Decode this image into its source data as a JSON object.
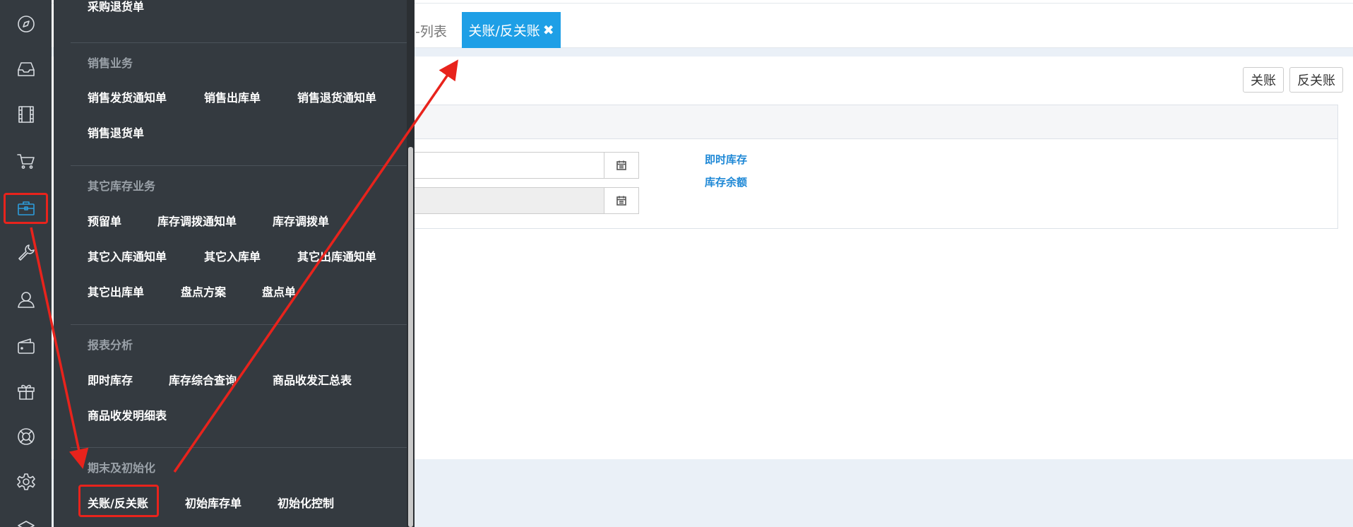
{
  "rail": {
    "icons": [
      "compass-icon",
      "inbox-icon",
      "film-icon",
      "cart-icon",
      "briefcase-icon",
      "wrench-icon",
      "user-icon",
      "wallet-icon",
      "gift-icon",
      "lifebuoy-icon",
      "gear-icon",
      "layers-icon"
    ],
    "active": "briefcase-icon",
    "active_color": "#2d9cdb"
  },
  "tabs": {
    "previous_label": "-列表",
    "active_label": "关账/反关账",
    "close_glyph": "✖",
    "active_color": "#1e9fe6"
  },
  "toolbar": {
    "close_label": "关账",
    "unclose_label": "反关账"
  },
  "side_links": {
    "realtime_stock": "即时库存",
    "stock_balance": "库存余额"
  },
  "menu": {
    "cut_item": "采购退货单",
    "sections": [
      {
        "title": "销售业务",
        "items": [
          "销售发货通知单",
          "销售出库单",
          "销售退货通知单",
          "销售退货单"
        ]
      },
      {
        "title": "其它库存业务",
        "items": [
          "预留单",
          "库存调拨通知单",
          "库存调拨单",
          "其它入库通知单",
          "其它入库单",
          "其它出库通知单",
          "其它出库单",
          "盘点方案",
          "盘点单"
        ]
      },
      {
        "title": "报表分析",
        "items": [
          "即时库存",
          "库存综合查询",
          "商品收发汇总表",
          "商品收发明细表"
        ]
      },
      {
        "title": "期末及初始化",
        "items": [
          "关账/反关账",
          "初始库存单",
          "初始化控制"
        ]
      }
    ]
  },
  "annotation_color": "#e8231c"
}
